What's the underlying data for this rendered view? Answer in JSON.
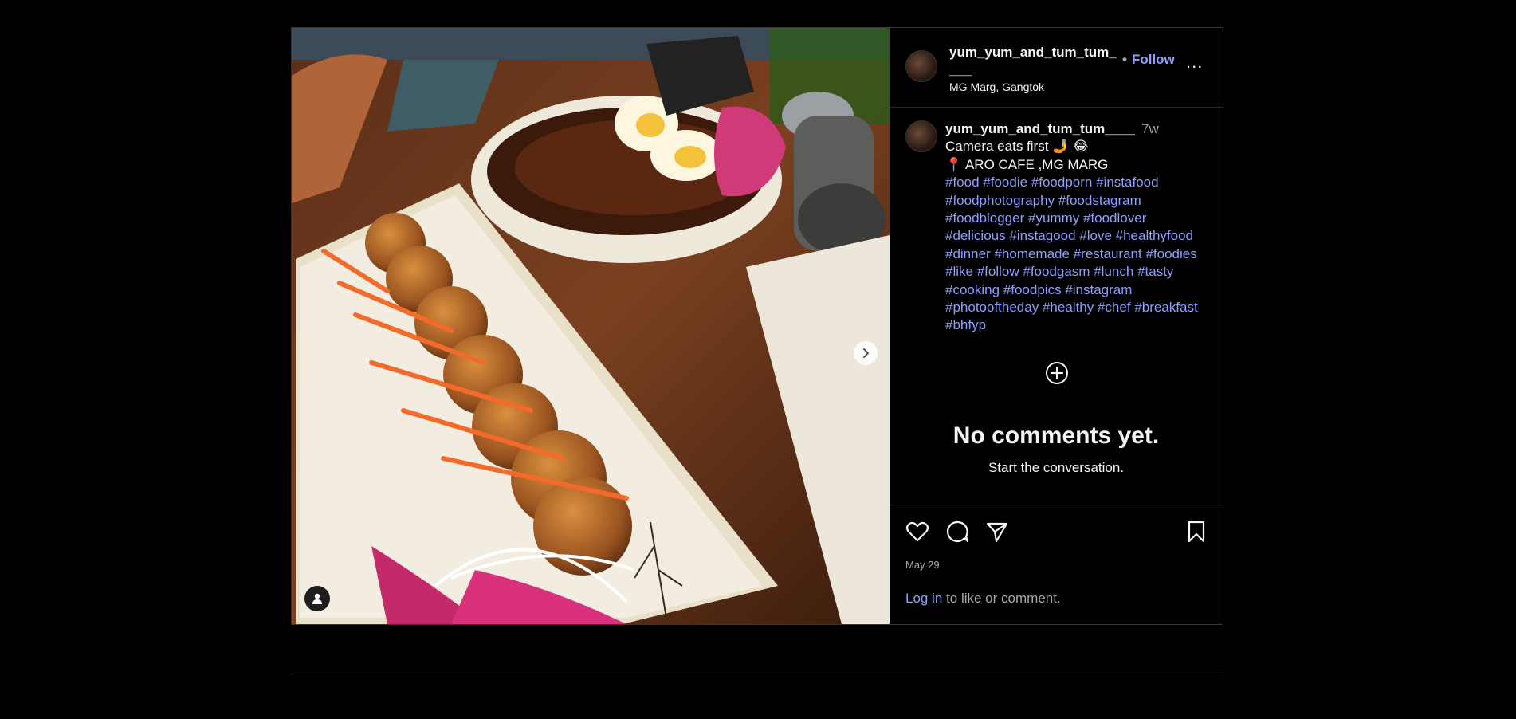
{
  "post": {
    "username": "yum_yum_and_tum_tum____",
    "follow_label": "Follow",
    "follow_dot": "•",
    "location": "MG Marg, Gangtok",
    "more_label": "...",
    "caption": {
      "username": "yum_yum_and_tum_tum____",
      "time": "7w",
      "line1": "Camera eats first 🤳 😂",
      "line2": "📍 ARO CAFE ,MG MARG",
      "hashtags": [
        "#food",
        "#foodie",
        "#foodporn",
        "#instafood",
        "#foodphotography",
        "#foodstagram",
        "#foodblogger",
        "#yummy",
        "#foodlover",
        "#delicious",
        "#instagood",
        "#love",
        "#healthyfood",
        "#dinner",
        "#homemade",
        "#restaurant",
        "#foodies",
        "#like",
        "#follow",
        "#foodgasm",
        "#lunch",
        "#tasty",
        "#cooking",
        "#foodpics",
        "#instagram",
        "#photooftheday",
        "#healthy",
        "#chef",
        "#breakfast",
        "#bhfyp"
      ]
    },
    "comments": {
      "empty_title": "No comments yet.",
      "empty_subtitle": "Start the conversation."
    },
    "date": "May 29",
    "login": {
      "link": "Log in",
      "rest": " to like or comment."
    },
    "carousel": {
      "slide_count": 10,
      "active_index": 0
    }
  },
  "icons": {
    "like": "heart-icon",
    "comment": "comment-icon",
    "share": "share-icon",
    "save": "bookmark-icon",
    "add_comment": "plus-circle-icon",
    "next": "chevron-right-icon",
    "tags": "user-tag-icon"
  },
  "colors": {
    "background": "#000000",
    "link": "#8f9eff",
    "muted": "#a8a8a8",
    "border": "#262626"
  }
}
